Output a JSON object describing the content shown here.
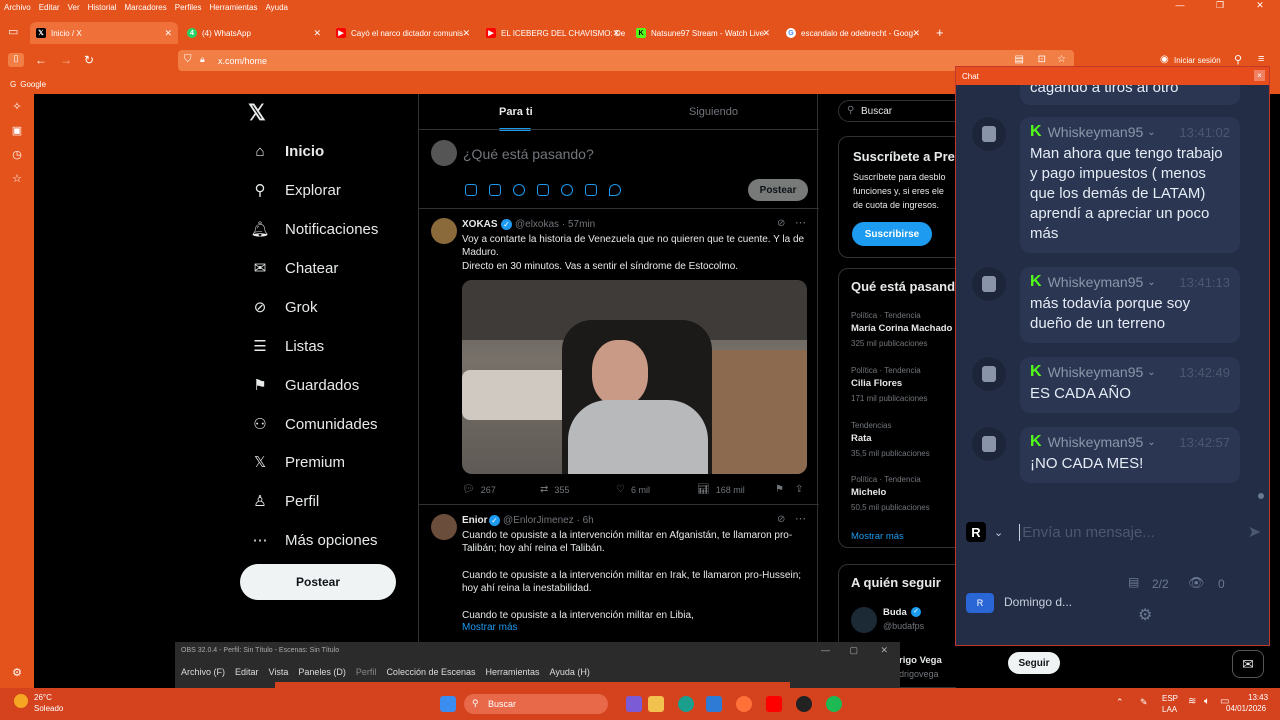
{
  "menubar": [
    "Archivo",
    "Editar",
    "Ver",
    "Historial",
    "Marcadores",
    "Perfiles",
    "Herramientas",
    "Ayuda"
  ],
  "tabs": [
    {
      "label": "Inicio / X",
      "icon": "x-logo-icon"
    },
    {
      "label": "(4) WhatsApp",
      "icon": "whatsapp-icon"
    },
    {
      "label": "Cayó el narco dictador comunis",
      "icon": "youtube-icon"
    },
    {
      "label": "EL ICEBERG DEL CHAVISMO: De",
      "icon": "youtube-icon"
    },
    {
      "label": "Natsune97 Stream - Watch Live",
      "icon": "kick-icon"
    },
    {
      "label": "escandalo de odebrecht - Goog",
      "icon": "google-icon"
    }
  ],
  "url": "x.com/home",
  "signin": "Iniciar sesión",
  "bookmark": "Google",
  "nav": [
    "Inicio",
    "Explorar",
    "Notificaciones",
    "Chatear",
    "Grok",
    "Listas",
    "Guardados",
    "Comunidades",
    "Premium",
    "Perfil",
    "Más opciones"
  ],
  "post_button": "Postear",
  "feed": {
    "tab_foryou": "Para ti",
    "tab_following": "Siguiendo",
    "composer_placeholder": "¿Qué está pasando?",
    "composer_button": "Postear",
    "tweet1": {
      "name": "XOKAS",
      "handle": "@elxokas · 57min",
      "text1": "Voy a contarte la historia de Venezuela que no quieren que te cuente. Y la de Maduro.",
      "text2": "Directo en 30 minutos. Vas a sentir el síndrome de Estocolmo.",
      "replies": "267",
      "reposts": "355",
      "likes": "6 mil",
      "views": "168 mil"
    },
    "tweet2": {
      "name": "Enior",
      "handle": "@EnlorJimenez · 6h",
      "p1": "Cuando te opusiste a la intervención militar en Afganistán, te llamaron pro-Talibán; hoy ahí reina el Talibán.",
      "p2": "Cuando te opusiste a la intervención militar en Irak, te llamaron pro-Hussein; hoy ahí reina la inestabilidad.",
      "p3": "Cuando te opusiste a la intervención militar en Libia,",
      "show_more": "Mostrar más"
    }
  },
  "right": {
    "search": "Buscar",
    "sub_title": "Suscríbete a Pre",
    "sub_text1": "Suscríbete para desblo",
    "sub_text2": "funciones y, si eres ele",
    "sub_text3": "de cuota de ingresos.",
    "sub_button": "Suscribirse",
    "trends_title": "Qué está pasando",
    "trends": [
      {
        "cat": "Política · Tendencia",
        "name": "María Corina Machado",
        "count": "325 mil publicaciones"
      },
      {
        "cat": "Política · Tendencia",
        "name": "Cilia Flores",
        "count": "171 mil publicaciones"
      },
      {
        "cat": "Tendencias",
        "name": "Rata",
        "count": "35,5 mil publicaciones"
      },
      {
        "cat": "Política · Tendencia",
        "name": "Michelo",
        "count": "50,5 mil publicaciones"
      }
    ],
    "show_more": "Mostrar más",
    "follow_title": "A quién seguir",
    "follow1_name": "Buda",
    "follow1_handle": "@budafps",
    "follow2_name": "rigo Vega",
    "follow2_handle": "drigovega",
    "follow_button": "Seguir"
  },
  "chat": {
    "title": "Chat",
    "top_fragment": "cagando a tiros al otro",
    "messages": [
      {
        "user": "Whiskeyman95",
        "time": "13:41:02",
        "text": "Man ahora que tengo trabajo y pago impuestos ( menos que los demás de LATAM) aprendí a apreciar un poco más"
      },
      {
        "user": "Whiskeyman95",
        "time": "13:41:13",
        "text": "más todavía porque soy dueño de un terreno"
      },
      {
        "user": "Whiskeyman95",
        "time": "13:42:49",
        "text": "ES CADA AÑO"
      },
      {
        "user": "Whiskeyman95",
        "time": "13:42:57",
        "text": "¡NO CADA MES!"
      }
    ],
    "input_placeholder": "Envía un mensaje...",
    "badge": "R",
    "viewers_ratio": "2/2",
    "viewers": "0",
    "channel": "Domingo d..."
  },
  "obs": {
    "title": "OBS 32.0.4 - Perfil: Sin Título - Escenas: Sin Título",
    "menu": [
      "Archivo (F)",
      "Editar",
      "Vista",
      "Paneles (D)",
      "Perfil",
      "Colección de Escenas",
      "Herramientas",
      "Ayuda (H)"
    ]
  },
  "taskbar": {
    "weather_temp": "26°C",
    "weather_text": "Soleado",
    "search": "Buscar",
    "lang": "ESP",
    "lang2": "LAA",
    "time": "13:43",
    "date": "04/01/2026"
  }
}
